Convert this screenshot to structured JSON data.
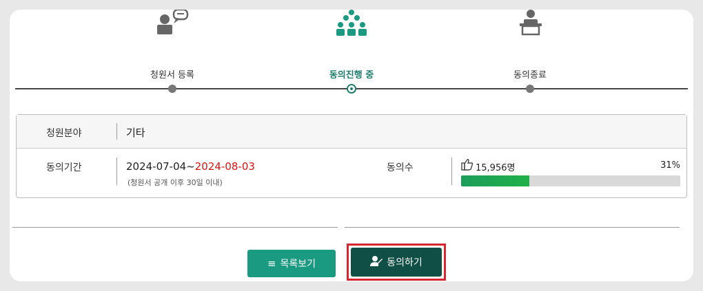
{
  "steps": {
    "items": [
      {
        "label": "청원서 등록",
        "icon": "speaker-chat-icon"
      },
      {
        "label": "동의진행 중",
        "icon": "crowd-icon"
      },
      {
        "label": "동의종료",
        "icon": "podium-icon"
      }
    ],
    "active_index": 1
  },
  "info": {
    "field_label": "청원분야",
    "field_value": "기타",
    "period_label": "동의기간",
    "period_start": "2024-07-04~",
    "period_end": "2024-08-03",
    "period_note": "(청원서 공개 이후 30일 이내)",
    "count_label": "동의수",
    "count_value": "15,956명",
    "percent_text": "31%",
    "progress_fraction": 0.31
  },
  "buttons": {
    "list_label": "목록보기",
    "agree_label": "동의하기"
  },
  "colors": {
    "accent": "#1a9a80",
    "dark_accent": "#0f4f45",
    "highlight_border": "#d7262f",
    "end_date": "#dd1111",
    "progress": "#20b04a"
  }
}
